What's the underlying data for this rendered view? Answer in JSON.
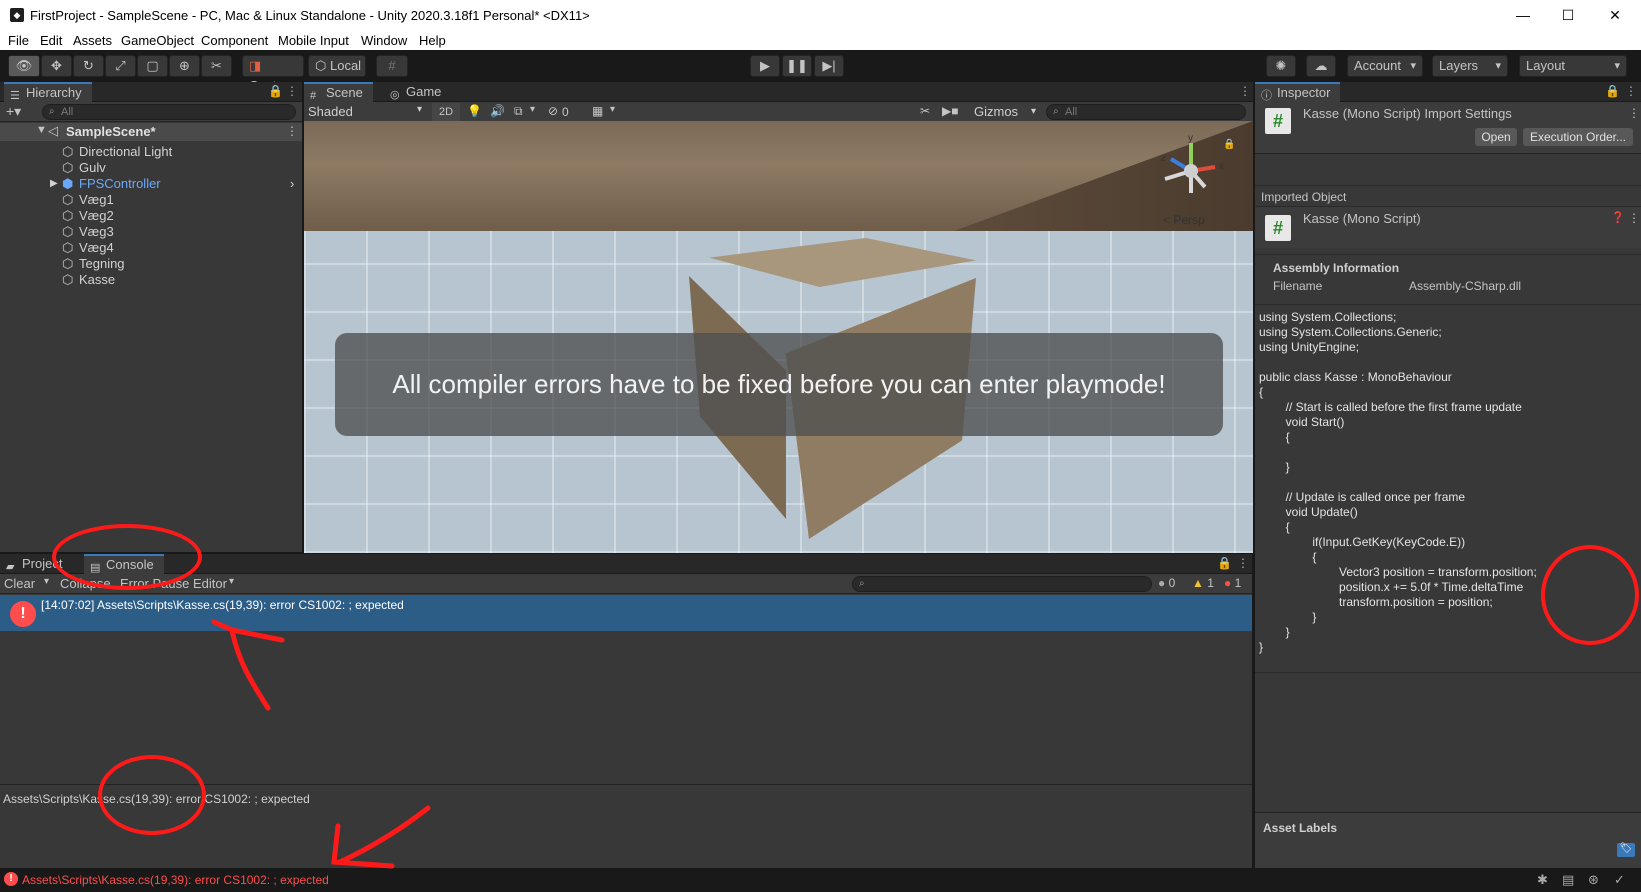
{
  "window": {
    "title": "FirstProject - SampleScene - PC, Mac & Linux Standalone - Unity 2020.3.18f1 Personal* <DX11>",
    "logo": "unity-icon",
    "minimize_glyph": "—",
    "maximize_glyph": "☐",
    "close_glyph": "✕"
  },
  "menu": [
    "File",
    "Edit",
    "Assets",
    "GameObject",
    "Component",
    "Mobile Input",
    "Window",
    "Help"
  ],
  "toolbar": {
    "pivot_label": "Center",
    "space_label": "Local",
    "account_label": "Account",
    "layers_label": "Layers",
    "layout_label": "Layout"
  },
  "hierarchy": {
    "tab_label": "Hierarchy",
    "search_placeholder": "All",
    "scene_name": "SampleScene*",
    "items": [
      "Directional Light",
      "Gulv",
      "FPSController",
      "Væg1",
      "Væg2",
      "Væg3",
      "Væg4",
      "Tegning",
      "Kasse"
    ]
  },
  "scene": {
    "tab_scene": "Scene",
    "tab_game": "Game",
    "draw_mode": "Shaded",
    "mode_2d": "2D",
    "hidden_count": "0",
    "gizmos_label": "Gizmos",
    "search_placeholder": "All",
    "persp_label": "Persp",
    "axis_x": "x",
    "axis_y": "y",
    "axis_z": "z",
    "message": "All compiler errors have to be fixed before you can enter playmode!"
  },
  "console": {
    "tab_project": "Project",
    "tab_console": "Console",
    "clear_label": "Clear",
    "collapse_label": "Collapse",
    "error_pause_label": "Error Pause",
    "editor_label": "Editor",
    "log_count": "0",
    "warn_count": "1",
    "error_count": "1",
    "entry": "[14:07:02] Assets\\Scripts\\Kasse.cs(19,39): error CS1002: ; expected",
    "detail": "Assets\\Scripts\\Kasse.cs(19,39): error CS1002: ; expected"
  },
  "inspector": {
    "tab_label": "Inspector",
    "header_title": "Kasse (Mono Script) Import Settings",
    "open_label": "Open",
    "execution_order_label": "Execution Order...",
    "imported_object_label": "Imported Object",
    "object_name": "Kasse (Mono Script)",
    "assembly_info_label": "Assembly Information",
    "filename_key": "Filename",
    "filename_value": "Assembly-CSharp.dll",
    "code": [
      "using System.Collections;",
      "using System.Collections.Generic;",
      "using UnityEngine;",
      "",
      "public class Kasse : MonoBehaviour",
      "{",
      "        // Start is called before the first frame update",
      "        void Start()",
      "        {",
      "",
      "        }",
      "",
      "        // Update is called once per frame",
      "        void Update()",
      "        {",
      "                if(Input.GetKey(KeyCode.E))",
      "                {",
      "                        Vector3 position = transform.position;",
      "                        position.x += 5.0f * Time.deltaTime",
      "                        transform.position = position;",
      "                }",
      "        }",
      "}"
    ],
    "asset_labels_label": "Asset Labels"
  },
  "status": {
    "message": "Assets\\Scripts\\Kasse.cs(19,39): error CS1002: ; expected"
  },
  "colors": {
    "accent_blue": "#2c5d87",
    "error_red": "#ff4c4c",
    "annotation_red": "#ff1a1a",
    "panel_bg": "#383838"
  }
}
